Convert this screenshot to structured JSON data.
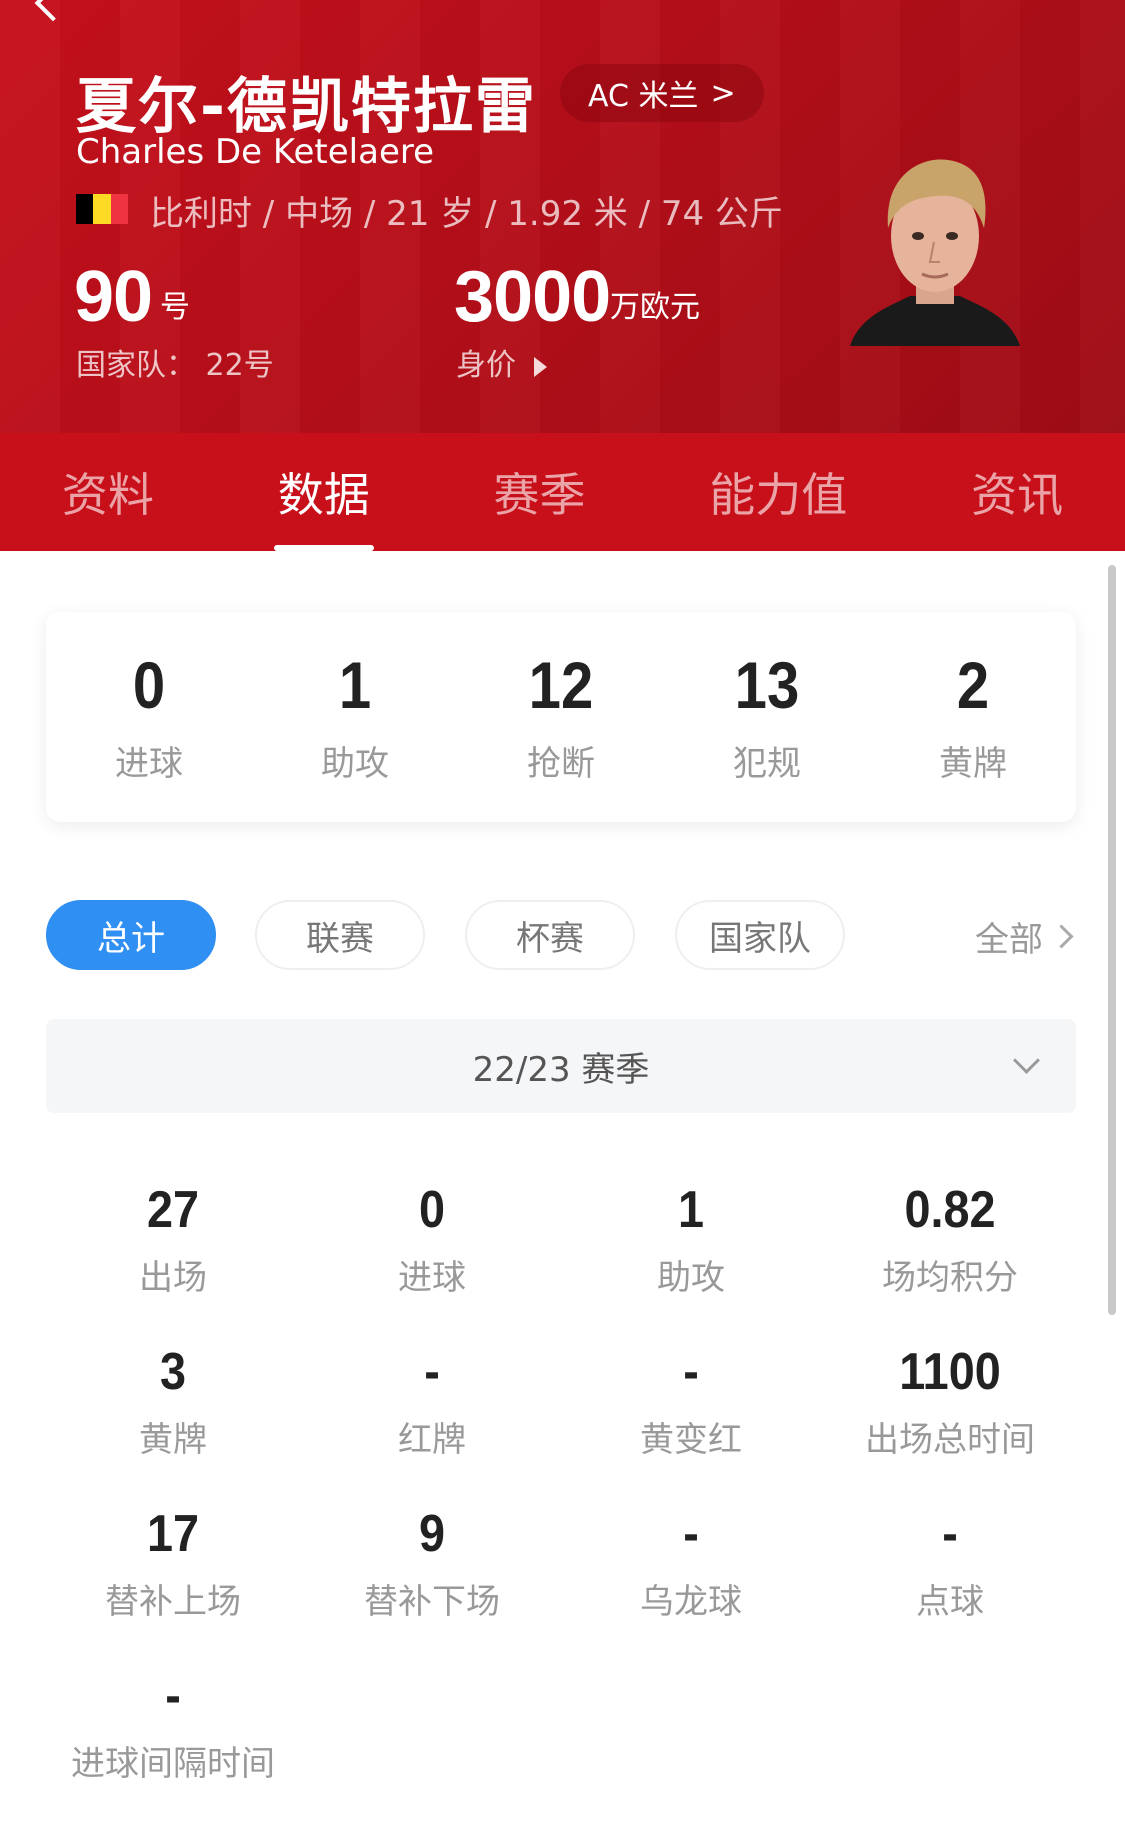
{
  "player": {
    "name_cn": "夏尔-德凯特拉雷",
    "name_en": "Charles De Ketelaere",
    "club": "AC 米兰",
    "club_chevron": ">",
    "bio": "比利时 / 中场 / 21 岁 / 1.92 米 / 74 公斤",
    "shirt_number": "90",
    "shirt_unit": "号",
    "national_number": "国家队：  22号",
    "market_value": "3000",
    "market_value_unit": "万欧元",
    "market_value_label": "身价"
  },
  "colors": {
    "brand_red": "#c8101b",
    "accent_blue": "#2f8ff2",
    "flag": [
      "#000000",
      "#fdda24",
      "#ef3340"
    ]
  },
  "tabs": [
    {
      "label": "资料",
      "active": false
    },
    {
      "label": "数据",
      "active": true
    },
    {
      "label": "赛季",
      "active": false
    },
    {
      "label": "能力值",
      "active": false
    },
    {
      "label": "资讯",
      "active": false
    }
  ],
  "summary": [
    {
      "value": "0",
      "label": "进球"
    },
    {
      "value": "1",
      "label": "助攻"
    },
    {
      "value": "12",
      "label": "抢断"
    },
    {
      "value": "13",
      "label": "犯规"
    },
    {
      "value": "2",
      "label": "黄牌"
    }
  ],
  "filters": [
    {
      "label": "总计",
      "active": true
    },
    {
      "label": "联赛",
      "active": false
    },
    {
      "label": "杯赛",
      "active": false
    },
    {
      "label": "国家队",
      "active": false
    }
  ],
  "filter_all": "全部",
  "season": "22/23 赛季",
  "stats": [
    {
      "value": "27",
      "label": "出场"
    },
    {
      "value": "0",
      "label": "进球"
    },
    {
      "value": "1",
      "label": "助攻"
    },
    {
      "value": "0.82",
      "label": "场均积分"
    },
    {
      "value": "3",
      "label": "黄牌"
    },
    {
      "value": "-",
      "label": "红牌"
    },
    {
      "value": "-",
      "label": "黄变红"
    },
    {
      "value": "1100",
      "label": "出场总时间"
    },
    {
      "value": "17",
      "label": "替补上场"
    },
    {
      "value": "9",
      "label": "替补下场"
    },
    {
      "value": "-",
      "label": "乌龙球"
    },
    {
      "value": "-",
      "label": "点球"
    },
    {
      "value": "-",
      "label": "进球间隔时间"
    }
  ]
}
